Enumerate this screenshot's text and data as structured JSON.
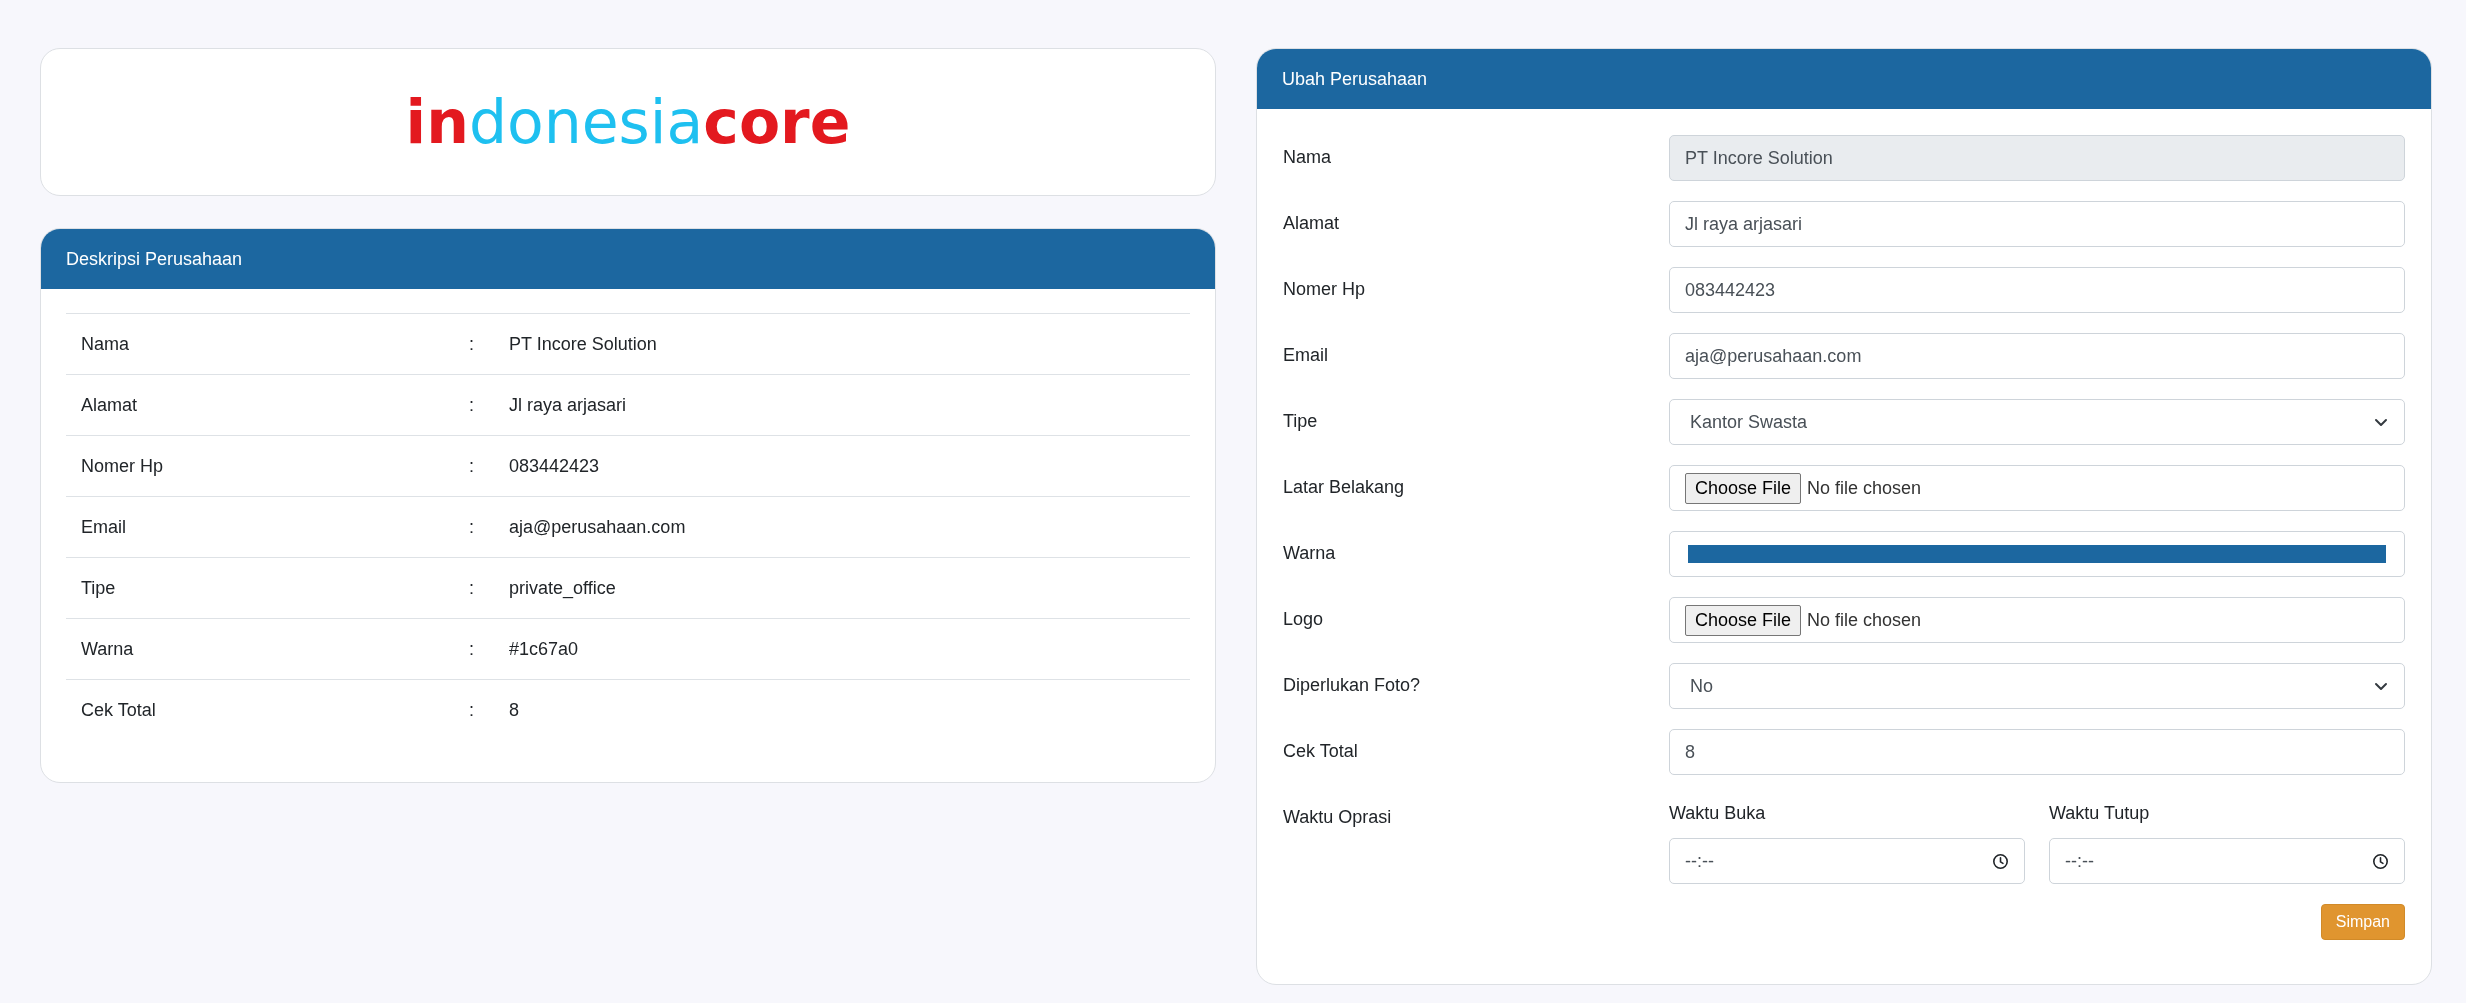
{
  "logo": {
    "parts": [
      {
        "text": "in",
        "color": "#e3191f",
        "kind": "bold"
      },
      {
        "text": "donesia",
        "color": "#1ec0f0",
        "kind": "light"
      },
      {
        "text": "core",
        "color": "#e3191f",
        "kind": "bold"
      }
    ]
  },
  "description": {
    "title": "Deskripsi Perusahaan",
    "rows": [
      {
        "label": "Nama",
        "separator": ":",
        "value": "PT Incore Solution"
      },
      {
        "label": "Alamat",
        "separator": ":",
        "value": "Jl raya arjasari"
      },
      {
        "label": "Nomer Hp",
        "separator": ":",
        "value": "083442423"
      },
      {
        "label": "Email",
        "separator": ":",
        "value": "aja@perusahaan.com"
      },
      {
        "label": "Tipe",
        "separator": ":",
        "value": "private_office"
      },
      {
        "label": "Warna",
        "separator": ":",
        "value": "#1c67a0"
      },
      {
        "label": "Cek Total",
        "separator": ":",
        "value": "8"
      }
    ]
  },
  "form": {
    "title": "Ubah Perusahaan",
    "fields": [
      {
        "kind": "text",
        "label": "Nama",
        "value": "PT Incore Solution",
        "disabled": true
      },
      {
        "kind": "text",
        "label": "Alamat",
        "value": "Jl raya arjasari",
        "disabled": false
      },
      {
        "kind": "text",
        "label": "Nomer Hp",
        "value": "083442423",
        "disabled": false
      },
      {
        "kind": "text",
        "label": "Email",
        "value": "aja@perusahaan.com",
        "disabled": false
      },
      {
        "kind": "select",
        "label": "Tipe",
        "value": "Kantor Swasta"
      },
      {
        "kind": "file",
        "label": "Latar Belakang",
        "button": "Choose File",
        "status": "No file chosen"
      },
      {
        "kind": "color",
        "label": "Warna",
        "color": "#1c67a0"
      },
      {
        "kind": "file",
        "label": "Logo",
        "button": "Choose File",
        "status": "No file chosen"
      },
      {
        "kind": "select",
        "label": "Diperlukan Foto?",
        "value": "No"
      },
      {
        "kind": "text",
        "label": "Cek Total",
        "value": "8",
        "disabled": false
      },
      {
        "kind": "time-pair",
        "label": "Waktu Oprasi",
        "times": [
          {
            "label": "Waktu Buka",
            "placeholder": "--:--"
          },
          {
            "label": "Waktu Tutup",
            "placeholder": "--:--"
          }
        ]
      }
    ],
    "submit": "Simpan"
  }
}
